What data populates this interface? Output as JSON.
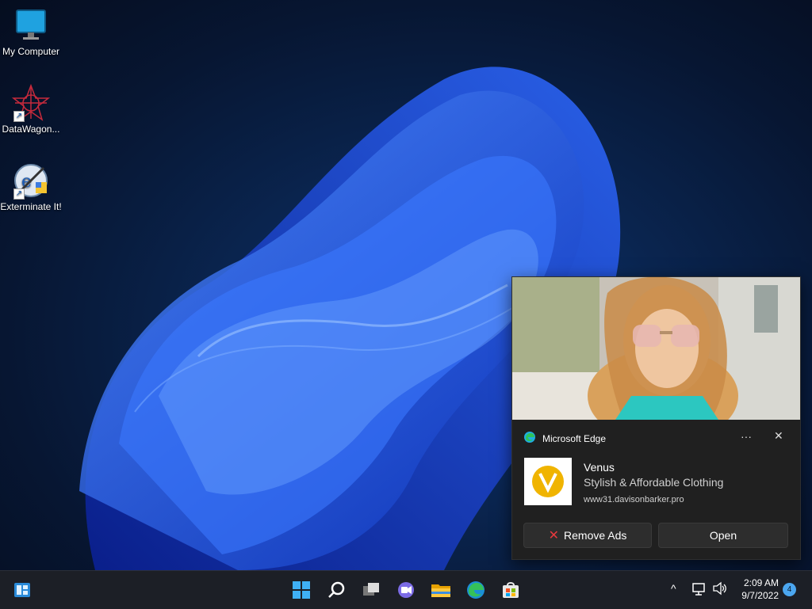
{
  "desktop": {
    "icons": [
      {
        "label": "My Computer",
        "icon": "monitor-icon"
      },
      {
        "label": "DataWagon...",
        "icon": "datawagon-icon"
      },
      {
        "label": "Exterminate It!",
        "icon": "exterminate-icon"
      }
    ]
  },
  "toast": {
    "app_name": "Microsoft Edge",
    "more_label": "···",
    "close_label": "✕",
    "ad_title": "Venus",
    "ad_subtitle": "Stylish & Affordable Clothing",
    "ad_url": "www31.davisonbarker.pro",
    "remove_label": "Remove Ads",
    "open_label": "Open",
    "accent_logo": "#f0b400"
  },
  "taskbar": {
    "apps": [
      "widgets-icon",
      "start-icon",
      "search-icon",
      "task-view-icon",
      "teams-chat-icon",
      "file-explorer-icon",
      "edge-icon",
      "store-icon"
    ],
    "tray": {
      "chevron": "^",
      "time": "2:09 AM",
      "date": "9/7/2022",
      "notification_count": "4"
    }
  }
}
